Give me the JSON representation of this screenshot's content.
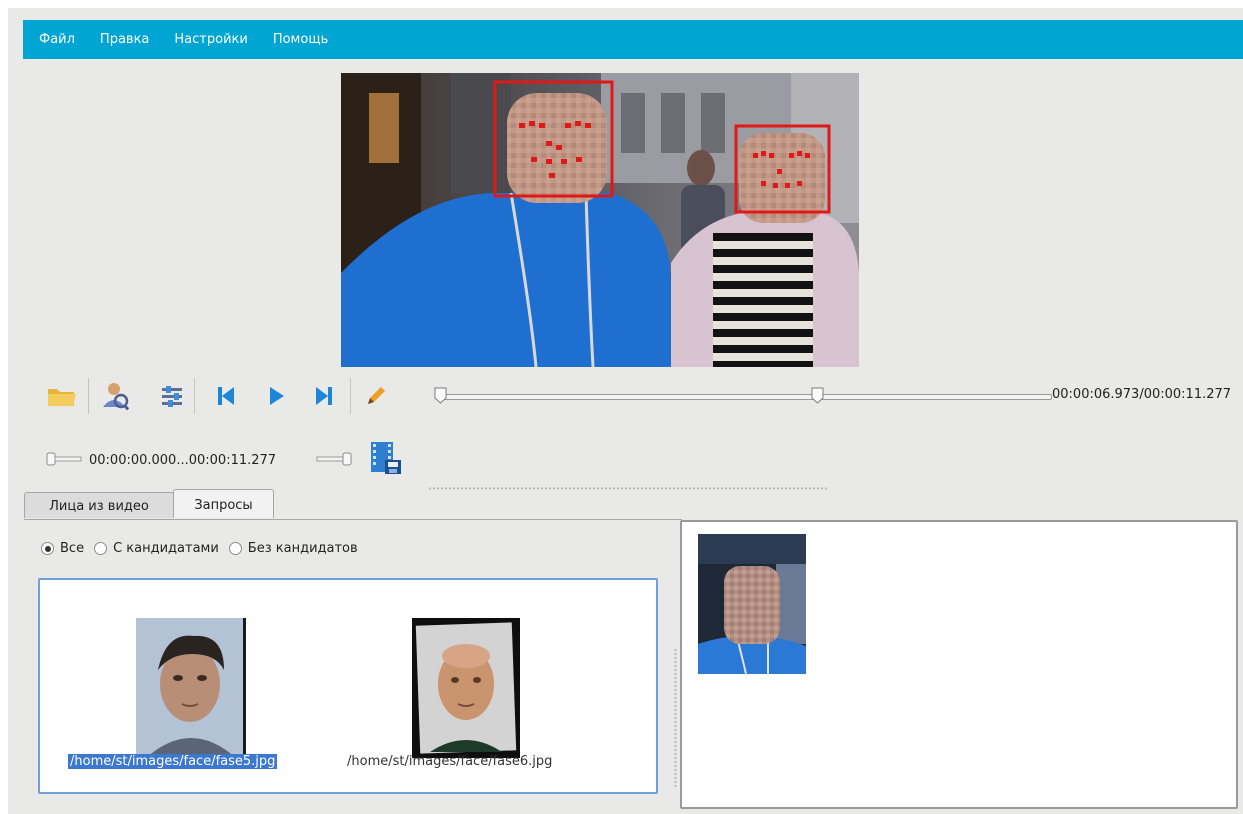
{
  "menu": {
    "items": [
      "Файл",
      "Правка",
      "Настройки",
      "Помощь"
    ]
  },
  "video": {
    "detected_faces": 2
  },
  "toolbar": {
    "icons": [
      "folder-open-icon",
      "search-person-icon",
      "sliders-icon",
      "skip-back-icon",
      "play-icon",
      "skip-forward-icon",
      "pencil-icon"
    ],
    "playback_progress": 0.618,
    "time_readout": "00:00:06.973/00:00:11.277"
  },
  "range": {
    "text": "00:00:00.000...00:00:11.277",
    "export_icon": "film-export-icon"
  },
  "tabs": [
    {
      "label": "Лица из видео",
      "active": false
    },
    {
      "label": "Запросы",
      "active": true
    }
  ],
  "filter": {
    "options": [
      {
        "label": "Все",
        "checked": true
      },
      {
        "label": "С кандидатами",
        "checked": false
      },
      {
        "label": "Без кандидатов",
        "checked": false
      }
    ]
  },
  "queries": [
    {
      "path": "/home/st/images/face/fase5.jpg",
      "selected": true
    },
    {
      "path": "/home/st/images/face/fase6.jpg",
      "selected": false
    }
  ],
  "colors": {
    "menubar": "#01a5d3",
    "selection": "#3d78cf",
    "detection_box": "#e01818",
    "list_border": "#6fa1d9"
  }
}
